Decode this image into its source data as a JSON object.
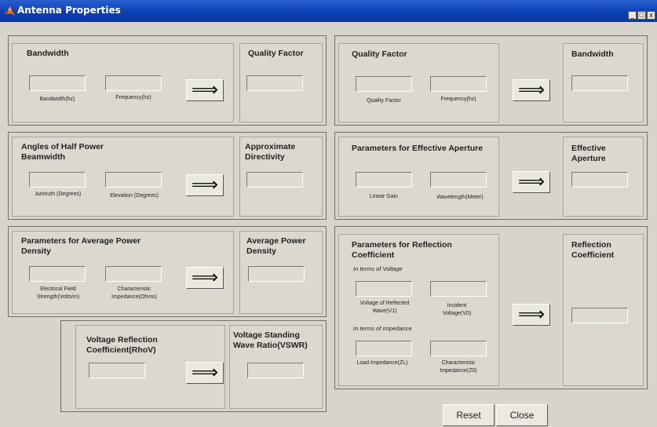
{
  "window": {
    "title": "Antenna Properties",
    "min_label": "_",
    "max_label": "□",
    "close_label": "x"
  },
  "arrow_glyph": "⟹",
  "p1": {
    "hdr": "Bandwidth",
    "lbl1": "Bandwidth(hz)",
    "lbl2": "Frequency(hz)",
    "out_hdr": "Quality Factor"
  },
  "p2": {
    "hdr": "Quality Factor",
    "lbl1": "Quality Factor",
    "lbl2": "Frequency(hz)",
    "out_hdr": "Bandwidth"
  },
  "p3": {
    "hdr": "Angles of Half Power Beamwidth",
    "lbl1": "Azimuth (Degrees)",
    "lbl2": "Elevation (Degrees)",
    "out_hdr": "Approximate Directivity"
  },
  "p4": {
    "hdr": "Parameters for Effective Aperture",
    "lbl1": "Linear Gain",
    "lbl2": "Wavelength(Meter)",
    "out_hdr": "Effective Aperture"
  },
  "p5": {
    "hdr": "Parameters for Average Power Density",
    "lbl1": "Electrical Field Strength(Volts/m)",
    "lbl2": "Characteristic Impedance(Ohms)",
    "out_hdr": "Average Power Density"
  },
  "p6": {
    "hdr": "Parameters for Reflection Coefficient",
    "sub1": "In terms of Voltage",
    "lbl1": "Voltage of Reflected Wave(V1)",
    "lbl2": "Incident Voltage(V0)",
    "sub2": "In terms of Impedance",
    "lbl3": "Load Impedance(ZL)",
    "lbl4": "Characteristic Impedance(Z0)",
    "out_hdr": "Reflection Coefficient"
  },
  "p7": {
    "hdr": "Voltage Reflection Coefficient(RhoV)",
    "out_hdr": "Voltage Standing Wave Ratio(VSWR)"
  },
  "buttons": {
    "reset": "Reset",
    "close": "Close"
  }
}
